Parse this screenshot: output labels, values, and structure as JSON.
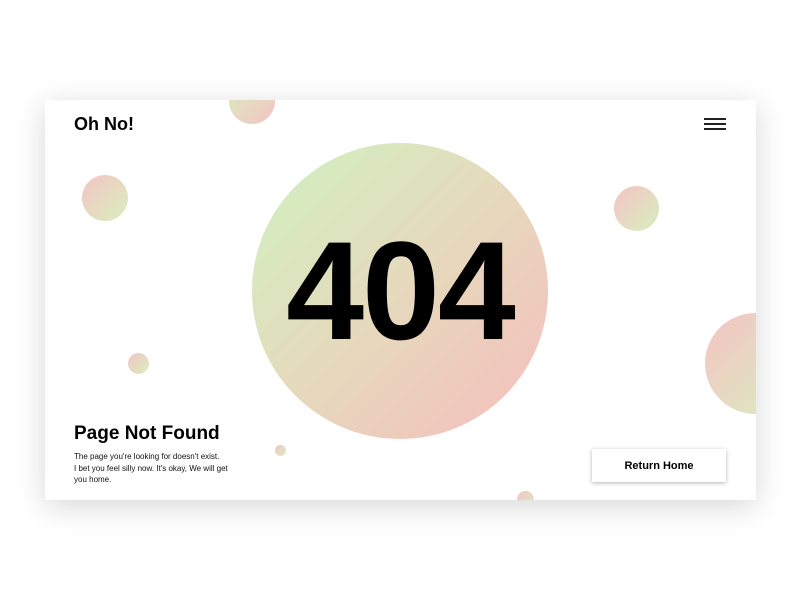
{
  "header": {
    "logo_text": "Oh No!",
    "menu_icon": "hamburger-menu-icon"
  },
  "hero": {
    "error_code": "404"
  },
  "message": {
    "title": "Page Not Found",
    "line1": "The page you're looking for doesn't exist.",
    "line2": "I bet you feel silly now. It's okay, We will get you home."
  },
  "actions": {
    "return_home_label": "Return Home"
  },
  "colors": {
    "gradient_green": "#d7efbf",
    "gradient_pink": "#f5c3c3",
    "text": "#000000",
    "background": "#ffffff"
  }
}
